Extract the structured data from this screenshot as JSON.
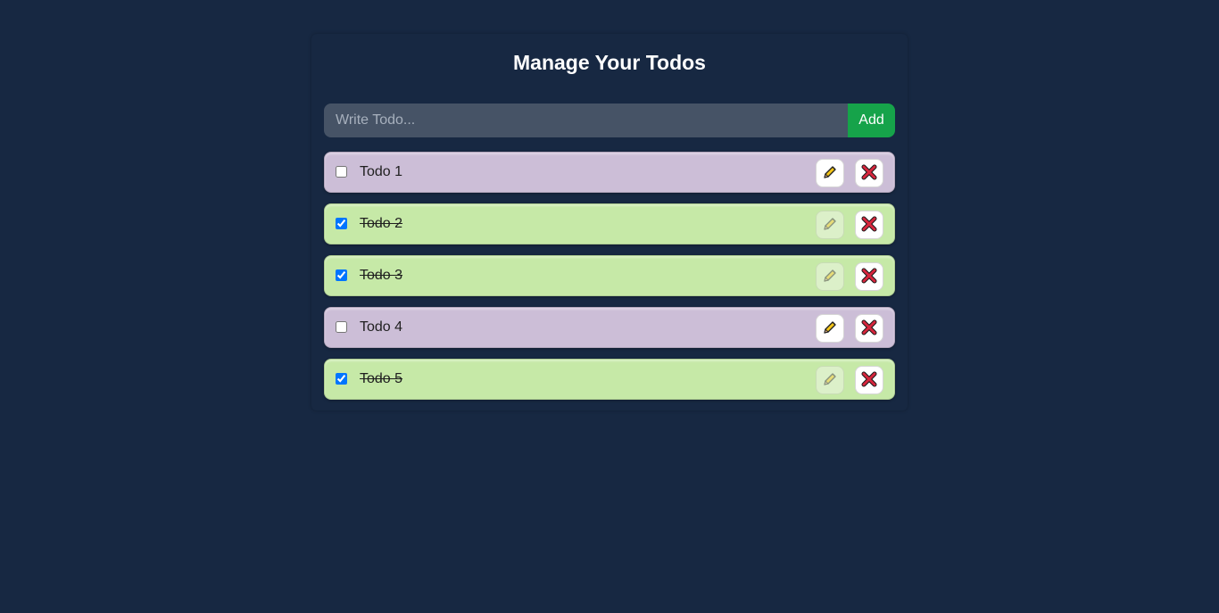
{
  "page": {
    "title": "Manage Your Todos"
  },
  "form": {
    "placeholder": "Write Todo...",
    "value": "",
    "add_label": "Add"
  },
  "todos": [
    {
      "label": "Todo 1",
      "completed": false
    },
    {
      "label": "Todo 2",
      "completed": true
    },
    {
      "label": "Todo 3",
      "completed": true
    },
    {
      "label": "Todo 4",
      "completed": false
    },
    {
      "label": "Todo 5",
      "completed": true
    }
  ],
  "icons": {
    "edit": "pencil-icon",
    "delete": "cross-mark-icon"
  },
  "colors": {
    "background": "#172842",
    "input_bg": "#465366",
    "add_button": "#16a34a",
    "pending_item": "#ccbed7",
    "completed_item": "#c6e9a7"
  }
}
